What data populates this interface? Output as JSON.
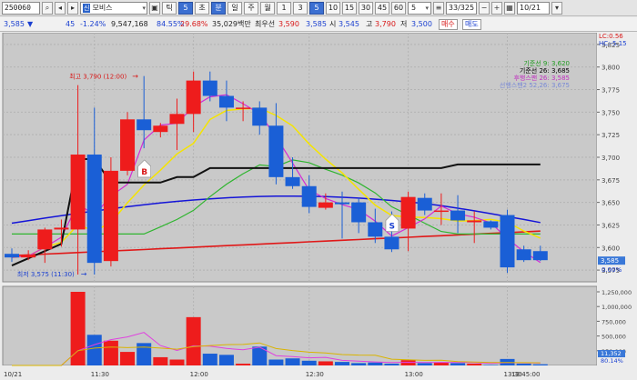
{
  "toolbar": {
    "code": "250060",
    "name_badge": "신",
    "name": "모비스",
    "periods": [
      "틱",
      "초",
      "분",
      "일",
      "주",
      "월"
    ],
    "period_values": [
      "틱",
      "5",
      "초",
      "분",
      "일",
      "주",
      "월"
    ],
    "interval_buttons": [
      "1",
      "3",
      "5",
      "10",
      "15",
      "30",
      "45",
      "60"
    ],
    "interval_selected": "5",
    "count_select": "5",
    "count_display": "33/325",
    "date": "10/21",
    "left_tags": [
      "틱",
      "5"
    ]
  },
  "info": {
    "price": "3,585",
    "arrow": "▼",
    "change": "45",
    "change_pct": "-1.24%",
    "volume": "9,547,168",
    "ratio1": "84.55%",
    "ratio2": "29.68%",
    "trade_value": "35,029백만",
    "price_label": "최우선",
    "best_ask": "3,590",
    "best_bid": "3,585",
    "low_label": "시",
    "open": "3,545",
    "high_label": "고",
    "high": "3,790",
    "low_label2": "저",
    "low": "3,500",
    "buy_button": "매수",
    "sell_button": "매도"
  },
  "chart_data": {
    "type": "candlestick",
    "date_label": "10/21",
    "time_ticks": [
      "11:30",
      "12:00",
      "12:30",
      "13:00",
      "13:30",
      "13:45:00"
    ],
    "price_axis": [
      "3,825",
      "3,800",
      "3,775",
      "3,750",
      "3,725",
      "3,700",
      "3,675",
      "3,650",
      "3,625",
      "3,600",
      "3,575"
    ],
    "ylim": [
      3562,
      3838
    ],
    "candles": [
      {
        "o": 3593,
        "h": 3599,
        "l": 3584,
        "c": 3589
      },
      {
        "o": 3589,
        "h": 3597,
        "l": 3586,
        "c": 3592
      },
      {
        "o": 3598,
        "h": 3622,
        "l": 3583,
        "c": 3620
      },
      {
        "o": 3620,
        "h": 3631,
        "l": 3601,
        "c": 3622
      },
      {
        "o": 3620,
        "h": 3780,
        "l": 3570,
        "c": 3703
      },
      {
        "o": 3703,
        "h": 3755,
        "l": 3570,
        "c": 3583
      },
      {
        "o": 3585,
        "h": 3700,
        "l": 3579,
        "c": 3685
      },
      {
        "o": 3685,
        "h": 3750,
        "l": 3680,
        "c": 3742
      },
      {
        "o": 3742,
        "h": 3790,
        "l": 3710,
        "c": 3730
      },
      {
        "o": 3728,
        "h": 3738,
        "l": 3722,
        "c": 3735
      },
      {
        "o": 3737,
        "h": 3765,
        "l": 3708,
        "c": 3748
      },
      {
        "o": 3748,
        "h": 3795,
        "l": 3728,
        "c": 3785
      },
      {
        "o": 3785,
        "h": 3795,
        "l": 3762,
        "c": 3768
      },
      {
        "o": 3768,
        "h": 3785,
        "l": 3740,
        "c": 3755
      },
      {
        "o": 3755,
        "h": 3762,
        "l": 3740,
        "c": 3755
      },
      {
        "o": 3755,
        "h": 3762,
        "l": 3725,
        "c": 3735
      },
      {
        "o": 3735,
        "h": 3760,
        "l": 3670,
        "c": 3678
      },
      {
        "o": 3678,
        "h": 3700,
        "l": 3665,
        "c": 3668
      },
      {
        "o": 3668,
        "h": 3680,
        "l": 3638,
        "c": 3645
      },
      {
        "o": 3644,
        "h": 3660,
        "l": 3642,
        "c": 3650
      },
      {
        "o": 3650,
        "h": 3662,
        "l": 3610,
        "c": 3648
      },
      {
        "o": 3650,
        "h": 3655,
        "l": 3616,
        "c": 3628
      },
      {
        "o": 3628,
        "h": 3643,
        "l": 3605,
        "c": 3612
      },
      {
        "o": 3612,
        "h": 3640,
        "l": 3595,
        "c": 3598
      },
      {
        "o": 3621,
        "h": 3662,
        "l": 3596,
        "c": 3656
      },
      {
        "o": 3655,
        "h": 3660,
        "l": 3636,
        "c": 3641
      },
      {
        "o": 3641,
        "h": 3660,
        "l": 3625,
        "c": 3641
      },
      {
        "o": 3641,
        "h": 3658,
        "l": 3616,
        "c": 3630
      },
      {
        "o": 3628,
        "h": 3640,
        "l": 3605,
        "c": 3630
      },
      {
        "o": 3629,
        "h": 3630,
        "l": 3620,
        "c": 3622
      },
      {
        "o": 3636,
        "h": 3642,
        "l": 3572,
        "c": 3578
      },
      {
        "o": 3598,
        "h": 3602,
        "l": 3584,
        "c": 3586
      },
      {
        "o": 3596,
        "h": 3602,
        "l": 3585,
        "c": 3586
      }
    ],
    "volume": [
      0,
      0,
      0,
      0,
      1250,
      520,
      420,
      230,
      380,
      140,
      100,
      820,
      200,
      180,
      30,
      320,
      100,
      120,
      80,
      70,
      60,
      40,
      50,
      30,
      90,
      40,
      50,
      40,
      30,
      10,
      110,
      30,
      20
    ],
    "volume_axis": [
      "1,250,000",
      "1,000,000",
      "750,000",
      "500,000",
      "250,000"
    ],
    "annotations": {
      "high": "최고 3,790 (12:00)",
      "low": "최저 3,575 (11:30)",
      "buy_signal": "B",
      "sell_signal": "S"
    },
    "legend": [
      {
        "label": "기준선 9: 3,620",
        "color": "#1f9b1f"
      },
      {
        "label": "기준선 26: 3,685",
        "color": "#000000"
      },
      {
        "label": "후행스팬 26: 3,585",
        "color": "#c030c0"
      },
      {
        "label": "선행스팬2 52,26: 3,675",
        "color": "#7a8ad6"
      }
    ],
    "right_top": [
      "LC:0.56",
      "HC:-5.15"
    ],
    "current_price_tag": "3,585",
    "current_pct_tag": "0.00%",
    "volume_pct_tag": "80.14%",
    "volume_current_tag": "11,352"
  }
}
